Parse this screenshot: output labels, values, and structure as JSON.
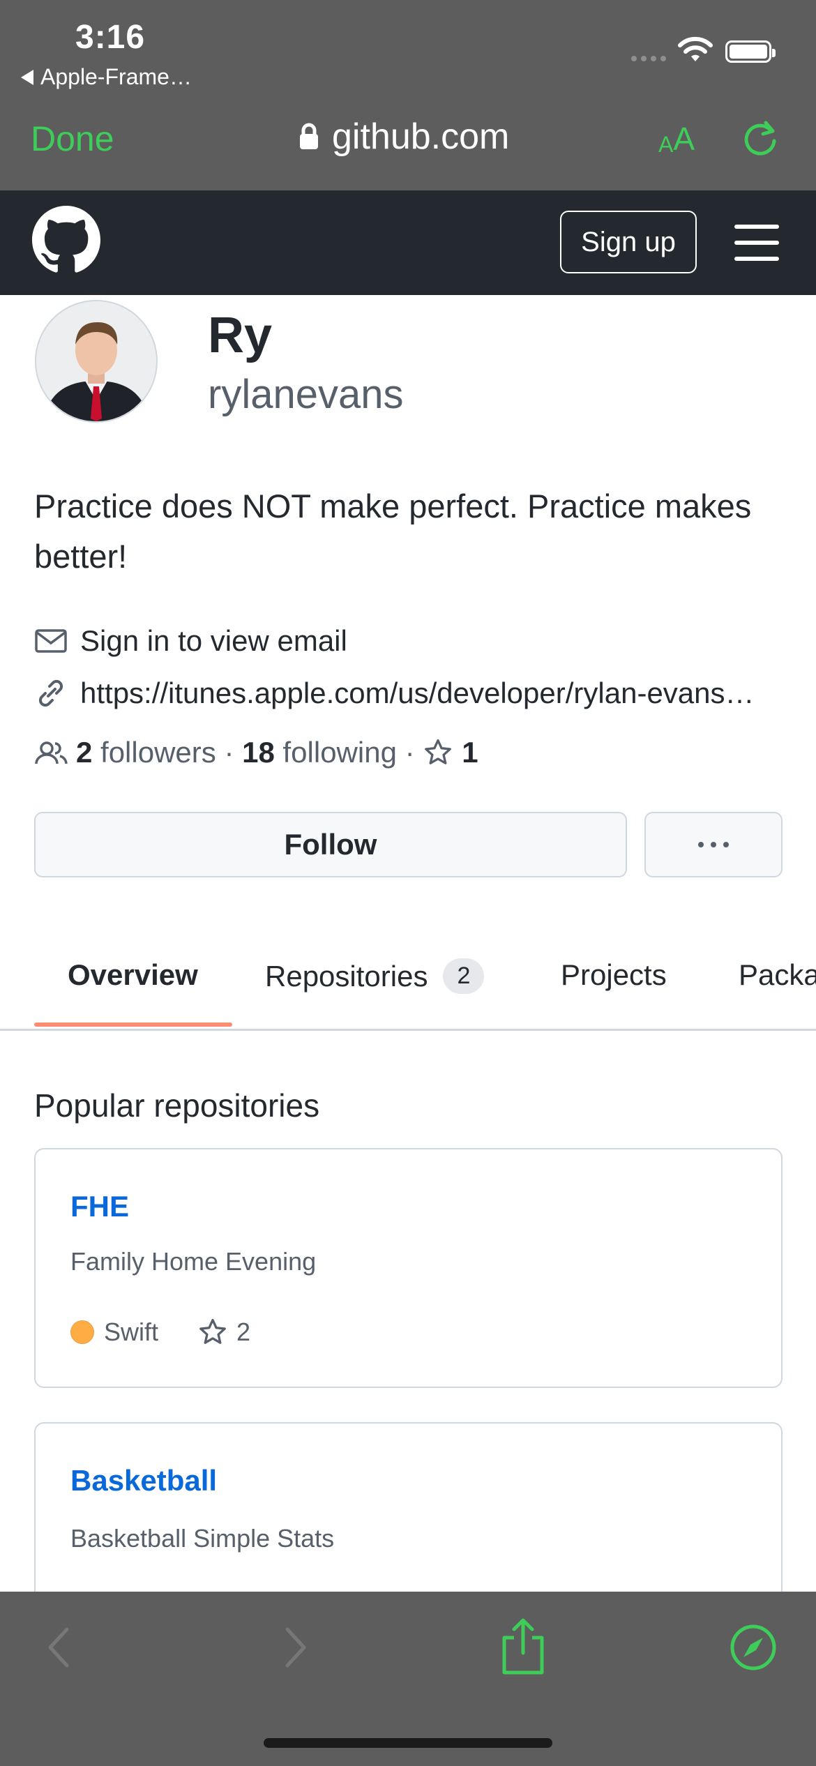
{
  "status_bar": {
    "time": "3:16",
    "back_app": "Apple-Frame…"
  },
  "browser": {
    "done_label": "Done",
    "url": "github.com",
    "text_size_small": "A",
    "text_size_large": "A",
    "accent_color": "#3ecd58"
  },
  "github_header": {
    "signup_label": "Sign up"
  },
  "profile": {
    "name": "Ry",
    "login": "rylanevans",
    "bio": "Practice does NOT make perfect. Practice makes better!",
    "email_text": "Sign in to view email",
    "website": "https://itunes.apple.com/us/developer/rylan-evans…",
    "followers_count": "2",
    "followers_label": "followers",
    "separator": "·",
    "following_count": "18",
    "following_label": "following",
    "stars_count": "1",
    "follow_label": "Follow"
  },
  "tabs": [
    {
      "label": "Overview",
      "active": true
    },
    {
      "label": "Repositories",
      "count": "2"
    },
    {
      "label": "Projects"
    },
    {
      "label": "Packages"
    }
  ],
  "popular": {
    "title": "Popular repositories",
    "repos": [
      {
        "name": "FHE",
        "description": "Family Home Evening",
        "language": "Swift",
        "language_color": "#ffac45",
        "stars": "2"
      },
      {
        "name": "Basketball",
        "description": "Basketball Simple Stats"
      }
    ]
  },
  "icons": [
    "lock-icon",
    "text-size-icon",
    "reload-icon",
    "github-logo-icon",
    "menu-icon",
    "mail-icon",
    "link-icon",
    "people-icon",
    "star-icon",
    "kebab-icon",
    "back-icon",
    "forward-icon",
    "share-icon",
    "compass-icon"
  ]
}
